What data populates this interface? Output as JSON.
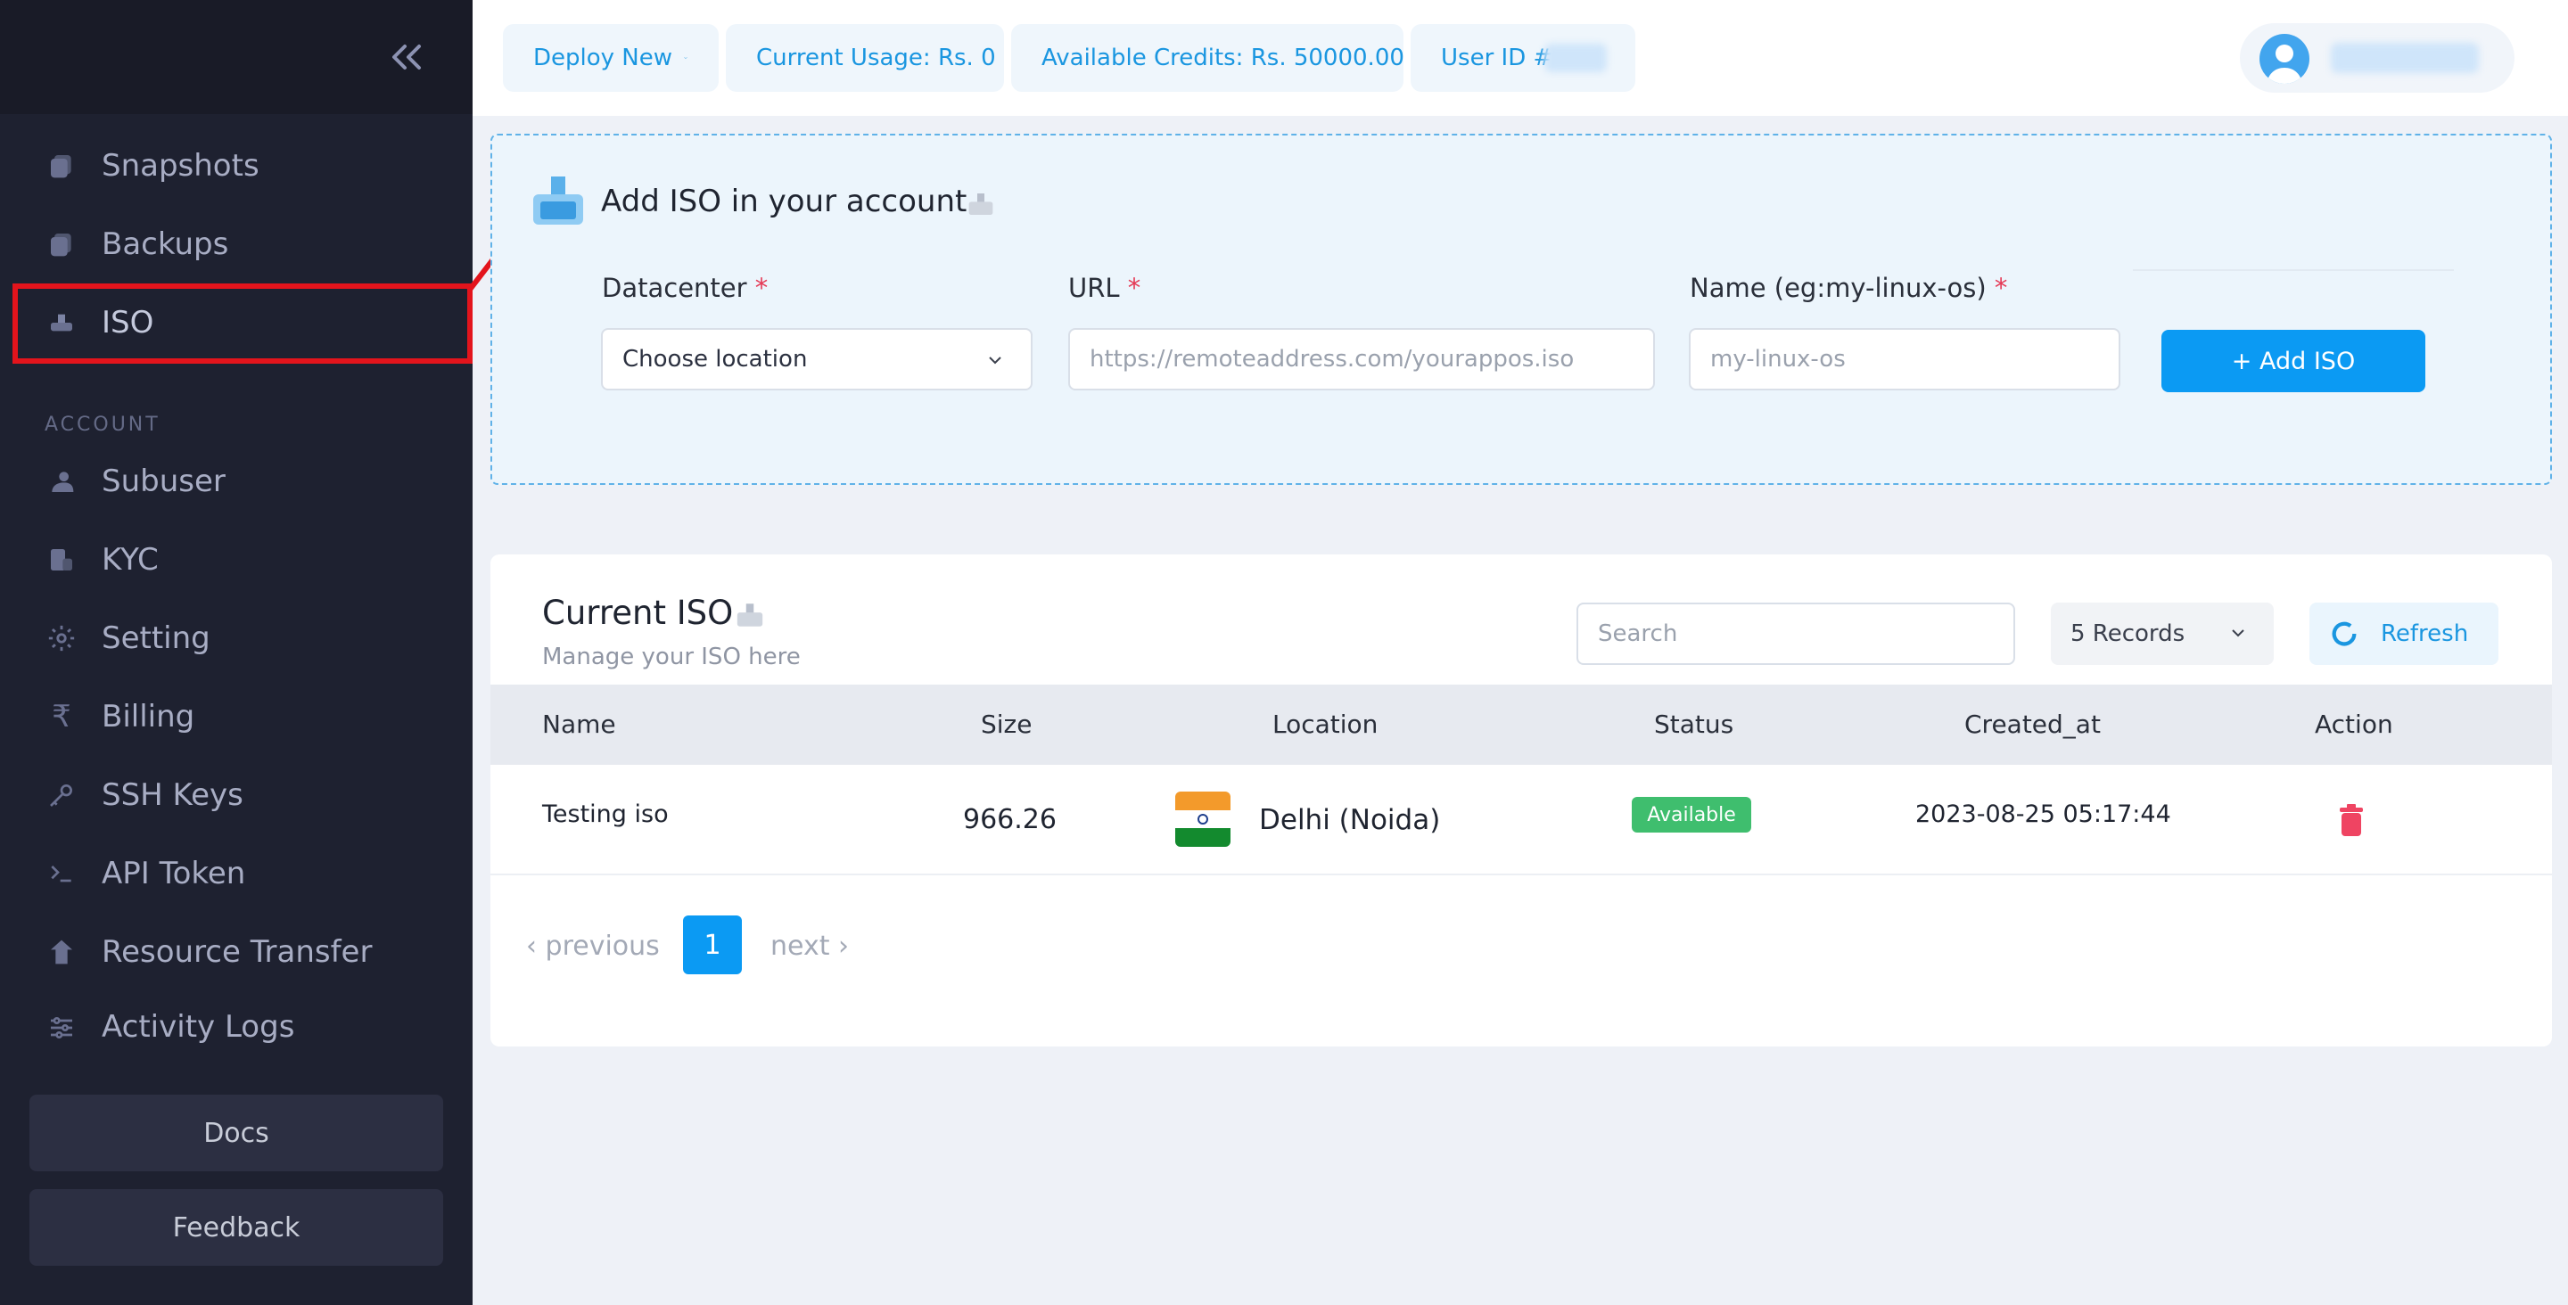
{
  "sidebar": {
    "items": [
      {
        "label": "Snapshots",
        "icon": "snapshot-icon"
      },
      {
        "label": "Backups",
        "icon": "backup-icon"
      },
      {
        "label": "ISO",
        "icon": "iso-icon"
      },
      {
        "label": "Subuser",
        "icon": "subuser-icon"
      },
      {
        "label": "KYC",
        "icon": "kyc-icon"
      },
      {
        "label": "Setting",
        "icon": "gear-icon"
      },
      {
        "label": "Billing",
        "icon": "rupee-icon"
      },
      {
        "label": "SSH Keys",
        "icon": "key-icon"
      },
      {
        "label": "API Token",
        "icon": "terminal-icon"
      },
      {
        "label": "Resource Transfer",
        "icon": "transfer-icon"
      },
      {
        "label": "Activity Logs",
        "icon": "sliders-icon"
      }
    ],
    "account_label": "ACCOUNT",
    "docs_label": "Docs",
    "feedback_label": "Feedback"
  },
  "topbar": {
    "deploy_label": "Deploy New",
    "usage_label": "Current Usage: Rs. 0",
    "credits_label": "Available Credits: Rs. 50000.00",
    "userid_label": "User ID #"
  },
  "add_iso": {
    "title": "Add ISO in your account",
    "datacenter_label": "Datacenter",
    "datacenter_value": "Choose location",
    "url_label": "URL",
    "url_placeholder": "https://remoteaddress.com/yourappos.iso",
    "name_label": "Name (eg:my-linux-os)",
    "name_placeholder": "my-linux-os",
    "required_mark": "*",
    "button_label": "+ Add ISO"
  },
  "current_iso": {
    "title": "Current ISO",
    "subtitle": "Manage your ISO here",
    "search_placeholder": "Search",
    "records_label": "5 Records",
    "refresh_label": "Refresh",
    "columns": [
      "Name",
      "Size",
      "Location",
      "Status",
      "Created_at",
      "Action"
    ],
    "rows": [
      {
        "name": "Testing iso",
        "size": "966.26",
        "location": "Delhi (Noida)",
        "status": "Available",
        "created_at": "2023-08-25 05:17:44"
      }
    ],
    "pagination": {
      "prev": "‹ previous",
      "page": "1",
      "next": "next ›"
    }
  },
  "colors": {
    "accent": "#0b9af3",
    "sidebar_bg": "#1e2130",
    "status_available": "#3fbe6e",
    "highlight": "#e3141c",
    "delete": "#ef4462"
  }
}
